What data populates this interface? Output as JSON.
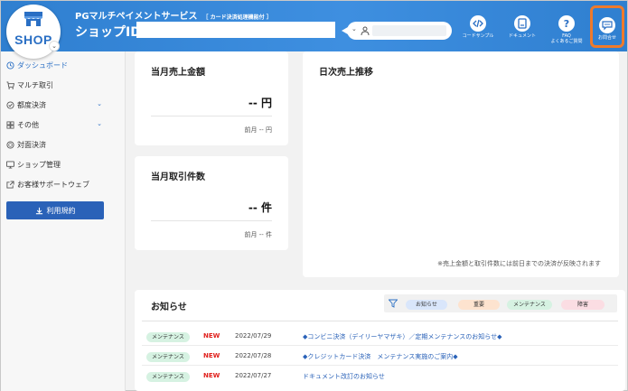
{
  "header": {
    "logo_text": "SHOP",
    "title": "PGマルチペイメントサービス",
    "title_tag": "［ カード決済処理機能付 ］",
    "shop_id_label": "ショップID:",
    "shop_id_value": "",
    "search_value": "",
    "buttons": [
      {
        "label": "コードサンプル",
        "icon": "code-icon"
      },
      {
        "label": "ドキュメント",
        "icon": "document-icon"
      },
      {
        "label": "FAQ",
        "label2": "よくあるご質問",
        "icon": "question-icon"
      },
      {
        "label": "お問合せ",
        "icon": "chat-icon"
      }
    ],
    "accent_color": "#ef7a2b"
  },
  "sidebar": {
    "items": [
      {
        "label": "ダッシュボード",
        "icon": "clock-icon",
        "active": true
      },
      {
        "label": "マルチ取引",
        "icon": "cart-icon"
      },
      {
        "label": "都度決済",
        "icon": "check-icon",
        "expandable": true
      },
      {
        "label": "その他",
        "icon": "grid-icon",
        "expandable": true
      },
      {
        "label": "対面決済",
        "icon": "coin-icon"
      },
      {
        "label": "ショップ管理",
        "icon": "monitor-icon"
      },
      {
        "label": "お客様サポートウェブ",
        "icon": "external-link-icon"
      }
    ],
    "terms_button": "利用規約"
  },
  "cards": {
    "monthly_sales": {
      "title": "当月売上金額",
      "value": "-- 円",
      "prev": "前月 -- 円"
    },
    "monthly_count": {
      "title": "当月取引件数",
      "value": "-- 件",
      "prev": "前月 -- 件"
    },
    "daily": {
      "title": "日次売上推移",
      "note": "※売上金額と取引件数には前日までの決済が反映されます"
    }
  },
  "news": {
    "title": "お知らせ",
    "filters": [
      {
        "label": "お知らせ",
        "color": "#d9e6fb"
      },
      {
        "label": "重要",
        "color": "#fde3cf"
      },
      {
        "label": "メンテナンス",
        "color": "#d6f2e2"
      },
      {
        "label": "障害",
        "color": "#fbdde3"
      }
    ],
    "rows": [
      {
        "badge": "メンテナンス",
        "new": "NEW",
        "date": "2022/07/29",
        "text": "◆コンビニ決済（デイリーヤマザキ）／定期メンテナンスのお知らせ◆"
      },
      {
        "badge": "メンテナンス",
        "new": "NEW",
        "date": "2022/07/28",
        "text": "◆クレジットカード決済　メンテナンス実施のご案内◆"
      },
      {
        "badge": "メンテナンス",
        "new": "NEW",
        "date": "2022/07/27",
        "text": "ドキュメント改訂のお知らせ"
      }
    ]
  }
}
